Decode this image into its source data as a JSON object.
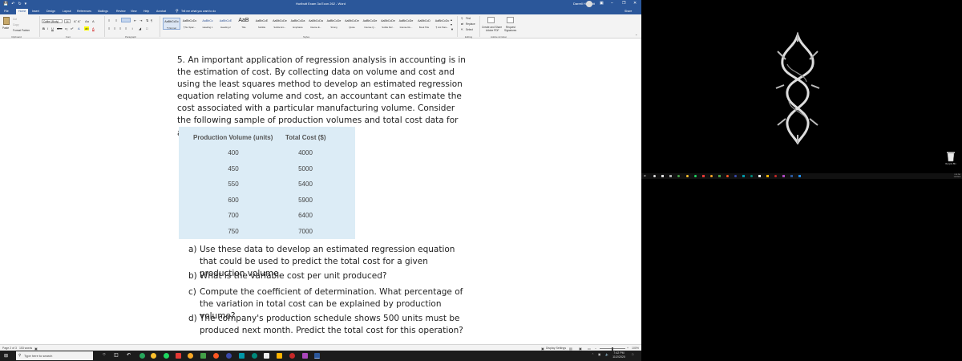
{
  "window": {
    "title": "Hurlbutt Exam 3a Econ 262  -  Word",
    "user": "Darrell Hurlbutt",
    "share_label": "Share",
    "tell_me": "Tell me what you want to do"
  },
  "tabs": [
    "File",
    "Home",
    "Insert",
    "Design",
    "Layout",
    "References",
    "Mailings",
    "Review",
    "View",
    "Help",
    "Acrobat"
  ],
  "ribbon": {
    "clipboard": {
      "paste": "Paste",
      "cut": "Cut",
      "copy": "Copy",
      "format_painter": "Format Painter",
      "label": "Clipboard"
    },
    "font": {
      "family": "Calibri (Body)",
      "size": "14",
      "label": "Font"
    },
    "paragraph": {
      "label": "Paragraph"
    },
    "styles": {
      "label": "Styles",
      "items": [
        {
          "sample": "AaBbCcDc",
          "name": "¶ Normal"
        },
        {
          "sample": "AaBbCcDc",
          "name": "¶ No Spac..."
        },
        {
          "sample": "AaBbCc",
          "name": "Heading 1"
        },
        {
          "sample": "AaBbCcE",
          "name": "Heading 2"
        },
        {
          "sample": "AaB",
          "name": "Title"
        },
        {
          "sample": "AaBbCcE",
          "name": "Subtitle"
        },
        {
          "sample": "AaBbCcDe",
          "name": "Subtle Em..."
        },
        {
          "sample": "AaBbCcDa",
          "name": "Emphasis"
        },
        {
          "sample": "AaBbCcDa",
          "name": "Intense E..."
        },
        {
          "sample": "AaBbCcDe",
          "name": "Strong"
        },
        {
          "sample": "AaBbCcDe",
          "name": "Quote"
        },
        {
          "sample": "AaBbCcDe",
          "name": "Intense Q..."
        },
        {
          "sample": "AaBbCcDe",
          "name": "Subtle Ref..."
        },
        {
          "sample": "AaBbCcDe",
          "name": "Intense Re..."
        },
        {
          "sample": "AaBbCcD",
          "name": "Book Title"
        },
        {
          "sample": "AaBbCcDc",
          "name": "¶ List Para..."
        }
      ]
    },
    "editing": {
      "find": "Find",
      "replace": "Replace",
      "select": "Select",
      "label": "Editing"
    },
    "adobe": {
      "create_share": "Create and Share",
      "adobe_pdf": "Adobe PDF",
      "request": "Request",
      "signatures": "Signatures",
      "label": "Adobe Acrobat"
    }
  },
  "document": {
    "question": "5. An important application of regression analysis in accounting is in the estimation of cost. By collecting data on volume and cost and using the least squares method to develop an estimated regression equation relating volume and cost, an accountant can estimate the cost associated with a particular manufacturing volume. Consider the following sample of production volumes and total cost data for a manufacturing operation.",
    "table": {
      "headers": [
        "Production Volume (units)",
        "Total Cost ($)"
      ],
      "rows": [
        [
          "400",
          "4000"
        ],
        [
          "450",
          "5000"
        ],
        [
          "550",
          "5400"
        ],
        [
          "600",
          "5900"
        ],
        [
          "700",
          "6400"
        ],
        [
          "750",
          "7000"
        ]
      ]
    },
    "subquestions": [
      {
        "label": "a)",
        "text": "Use these data to develop an estimated regression equation that could be used to predict the total cost for a given production volume."
      },
      {
        "label": "b)",
        "text": "What is the variable cost per unit produced?"
      },
      {
        "label": "c)",
        "text": "Compute the coefficient of determination. What percentage of the variation in total cost can be explained by production volume?"
      },
      {
        "label": "d)",
        "text": "The company's production schedule shows 500 units must be produced next month. Predict the total cost for this operation?"
      }
    ]
  },
  "statusbar": {
    "page": "Page 2 of 3",
    "words": "153 words",
    "display_settings": "Display Settings",
    "zoom": "100%"
  },
  "taskbar": {
    "search_placeholder": "Type here to search",
    "time": "7:42 PM",
    "date": "11/2/2020"
  },
  "desktop": {
    "recycle_label": "Recycle Bin",
    "mini_time": "7:42 PM",
    "mini_date": "11/2/2020"
  },
  "colors": {
    "word_blue": "#2b579a",
    "table_fill": "#dcecf6"
  }
}
